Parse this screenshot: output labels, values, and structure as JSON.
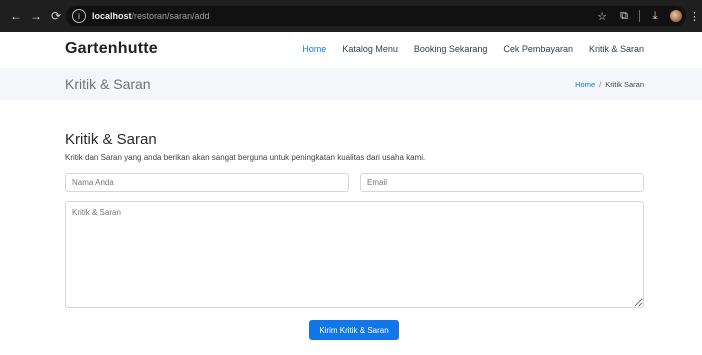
{
  "browser": {
    "url_host": "localhost",
    "url_path": "/restoran/saran/add",
    "icons": [
      "back-icon",
      "forward-icon",
      "reload-icon",
      "site-info-icon",
      "star-icon",
      "extensions-icon",
      "download-icon",
      "profile-avatar",
      "menu-icon"
    ]
  },
  "site": {
    "brand": "Gartenhutte",
    "nav": [
      {
        "label": "Home",
        "active": true
      },
      {
        "label": "Katalog Menu"
      },
      {
        "label": "Booking Sekarang"
      },
      {
        "label": "Cek Pembayaran"
      },
      {
        "label": "Kritik & Saran"
      }
    ]
  },
  "page_band": {
    "title": "Kritik & Saran",
    "breadcrumb": {
      "home": "Home",
      "separator": "/",
      "current": "Kritik Saran"
    }
  },
  "form": {
    "title": "Kritik & Saran",
    "description": "Kritik dan Saran yang anda berikan akan sangat berguna untuk peningkatan kualitas dari usaha kami.",
    "name_placeholder": "Nama Anda",
    "email_placeholder": "Email",
    "message_placeholder": "Kritik & Saran",
    "submit_label": "Kirim Kritik & Saran"
  },
  "colors": {
    "accent": "#1177e8",
    "nav_active": "#1779e6",
    "band_bg": "#f4f6f9",
    "browser_bg": "#1f1f1f"
  }
}
